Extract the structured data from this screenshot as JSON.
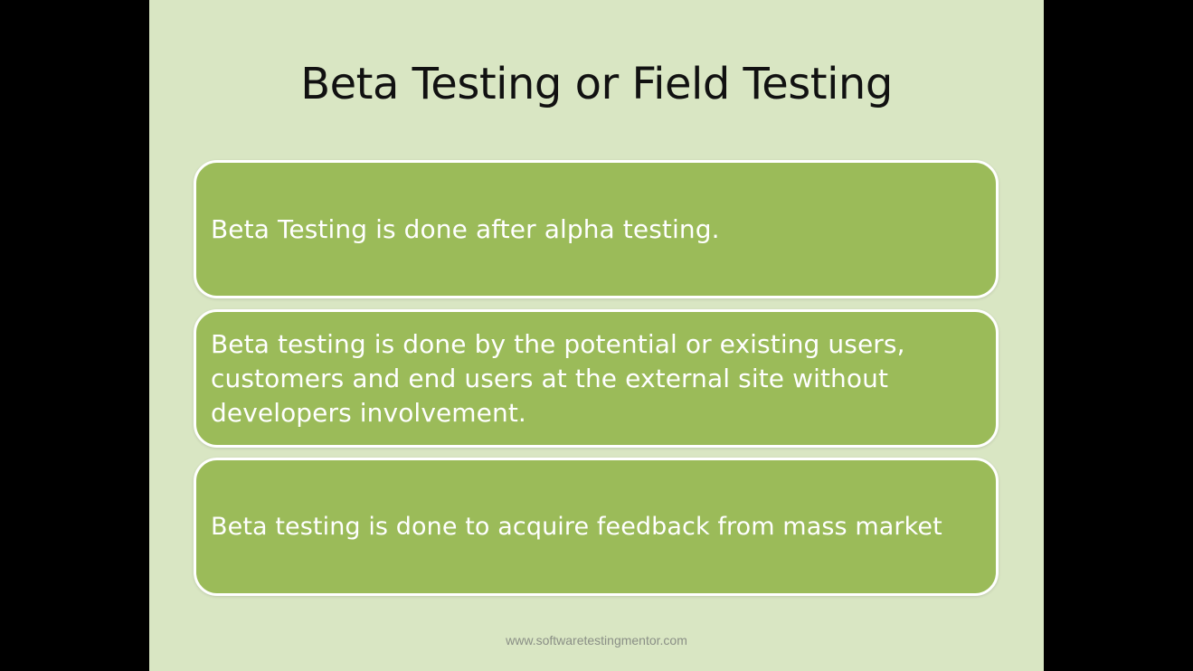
{
  "slide": {
    "title": "Beta Testing or Field Testing",
    "bullets": [
      {
        "text": "Beta Testing is done after alpha testing."
      },
      {
        "text": "Beta testing is done by the potential or existing users, customers and end users at the external site without developers involvement."
      },
      {
        "text": "Beta testing is done to acquire feedback from mass market"
      }
    ],
    "footer_url": "www.softwaretestingmentor.com"
  },
  "colors": {
    "letterbox": "#000000",
    "slide_background": "#d9e6c3",
    "box_fill": "#9bbb59",
    "box_border": "#ffffff",
    "title_text": "#111111",
    "box_text": "#ffffff"
  }
}
